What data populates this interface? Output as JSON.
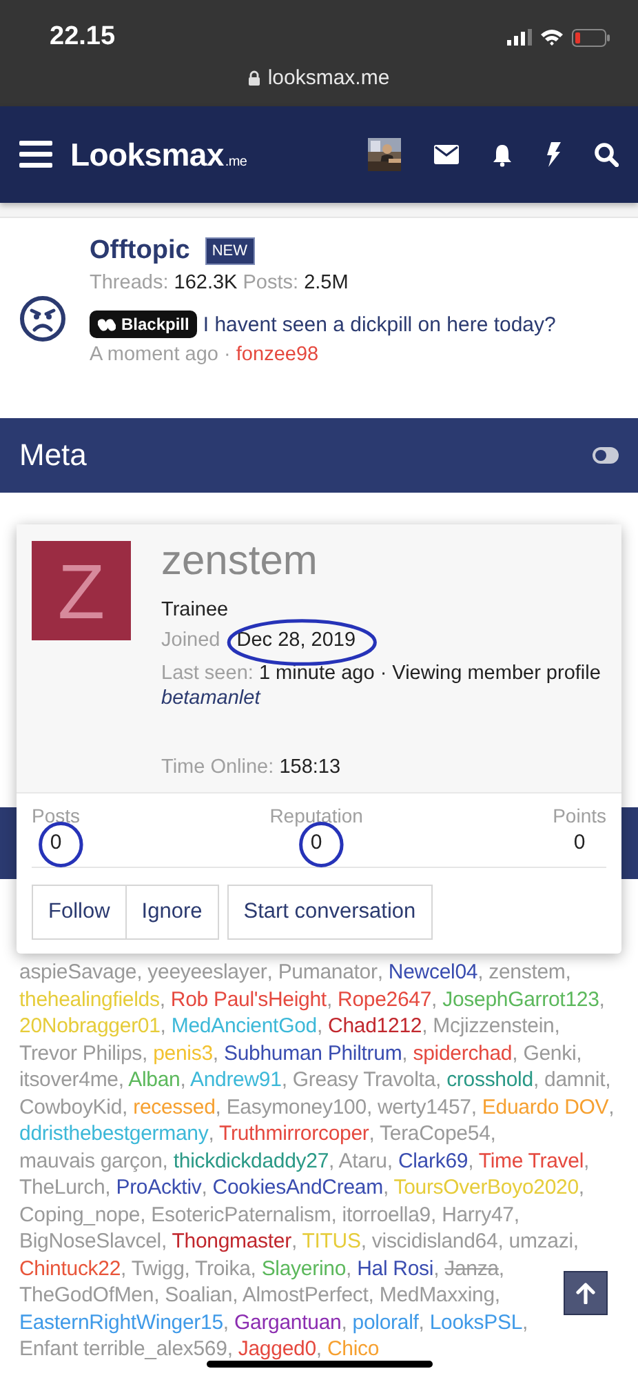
{
  "status_bar": {
    "time": "22.15",
    "url": "looksmax.me"
  },
  "nav": {
    "logo": "Looksmax",
    "logo_suffix": ".me"
  },
  "forum": {
    "title": "Offtopic",
    "badge": "NEW",
    "stats": [
      {
        "label": "Threads:",
        "value": "162.3K"
      },
      {
        "label": "Posts:",
        "value": "2.5M"
      }
    ],
    "latest": {
      "prefix": "Blackpill",
      "title": "I havent seen a dickpill on here today?",
      "time": "A moment ago",
      "separator": "·",
      "author": "fonzee98"
    }
  },
  "section": {
    "title": "Meta"
  },
  "member_card": {
    "avatar_letter": "Z",
    "username": "zenstem",
    "title": "Trainee",
    "joined_label": "Joined",
    "joined": "Dec 28, 2019",
    "joined_circled": true,
    "last_seen_label": "Last seen:",
    "last_seen": "1 minute ago · Viewing member profile",
    "activity_link": "betamanlet",
    "time_online_label": "Time Online:",
    "time_online": "158:13",
    "stats": [
      {
        "label": "Posts",
        "value": "0",
        "circled": true
      },
      {
        "label": "Reputation",
        "value": "0",
        "circled": true
      },
      {
        "label": "Points",
        "value": "0",
        "circled": false
      }
    ],
    "buttons": [
      "Follow",
      "Ignore",
      "Start conversation"
    ]
  },
  "online_users": {
    "separator": ",",
    "names": [
      {
        "name": "aspieSavage",
        "color": "#9a9a9a"
      },
      {
        "name": "yeeyeeslayer",
        "color": "#9a9a9a"
      },
      {
        "name": "Pumanator",
        "color": "#9a9a9a"
      },
      {
        "name": "Newcel04",
        "color": "#3a4db0"
      },
      {
        "name": "zenstem",
        "color": "#9a9a9a"
      },
      {
        "name": "thehealingfields",
        "color": "#e6cc3a"
      },
      {
        "name": "Rob Paul'sHeight",
        "color": "#e5493f"
      },
      {
        "name": "Rope2647",
        "color": "#e5493f"
      },
      {
        "name": "JosephGarrot123",
        "color": "#5cb85c"
      },
      {
        "name": "20Nobragger01",
        "color": "#e6cc3a"
      },
      {
        "name": "MedAncientGod",
        "color": "#3cb8d8"
      },
      {
        "name": "Chad1212",
        "color": "#c1272d"
      },
      {
        "name": "Mcjizzenstein",
        "color": "#9a9a9a"
      },
      {
        "name": "Trevor Philips",
        "color": "#9a9a9a"
      },
      {
        "name": "penis3",
        "color": "#f2c230"
      },
      {
        "name": "Subhuman Philtrum",
        "color": "#3a4db0"
      },
      {
        "name": "spiderchad",
        "color": "#e5493f"
      },
      {
        "name": "Genki",
        "color": "#9a9a9a"
      },
      {
        "name": "itsover4me",
        "color": "#9a9a9a"
      },
      {
        "name": "Alban",
        "color": "#5cb85c"
      },
      {
        "name": "Andrew91",
        "color": "#3cb8d8"
      },
      {
        "name": "Greasy Travolta",
        "color": "#9a9a9a"
      },
      {
        "name": "crosshold",
        "color": "#2a9986"
      },
      {
        "name": "damnit",
        "color": "#9a9a9a"
      },
      {
        "name": "CowboyKid",
        "color": "#9a9a9a"
      },
      {
        "name": "recessed",
        "color": "#f6a030"
      },
      {
        "name": "Easymoney100",
        "color": "#9a9a9a"
      },
      {
        "name": "werty1457",
        "color": "#9a9a9a"
      },
      {
        "name": "Eduardo DOV",
        "color": "#f6a030"
      },
      {
        "name": "ddristhebestgermany",
        "color": "#3cb8d8"
      },
      {
        "name": "Truthmirrorcoper",
        "color": "#e5493f"
      },
      {
        "name": "TeraCope54",
        "color": "#9a9a9a"
      },
      {
        "name": "mauvais garçon",
        "color": "#9a9a9a"
      },
      {
        "name": "thickdickdaddy27",
        "color": "#2a9986"
      },
      {
        "name": "Ataru",
        "color": "#9a9a9a"
      },
      {
        "name": "Clark69",
        "color": "#3a4db0"
      },
      {
        "name": "Time Travel",
        "color": "#e5493f"
      },
      {
        "name": "TheLurch",
        "color": "#9a9a9a"
      },
      {
        "name": "ProAcktiv",
        "color": "#3a4db0"
      },
      {
        "name": "CookiesAndCream",
        "color": "#3a4db0"
      },
      {
        "name": "ToursOverBoyo2020",
        "color": "#e6cc3a"
      },
      {
        "name": "Coping_nope",
        "color": "#9a9a9a"
      },
      {
        "name": "EsotericPaternalism",
        "color": "#9a9a9a"
      },
      {
        "name": "itorroella9",
        "color": "#9a9a9a"
      },
      {
        "name": "Harry47",
        "color": "#9a9a9a"
      },
      {
        "name": "BigNoseSlavcel",
        "color": "#9a9a9a"
      },
      {
        "name": "Thongmaster",
        "color": "#c1272d"
      },
      {
        "name": "TITUS",
        "color": "#e6cc3a"
      },
      {
        "name": "viscidisland64",
        "color": "#9a9a9a"
      },
      {
        "name": "umzazi",
        "color": "#9a9a9a"
      },
      {
        "name": "Chintuck22",
        "color": "#e8553a"
      },
      {
        "name": "Twigg",
        "color": "#9a9a9a"
      },
      {
        "name": "Troika",
        "color": "#9a9a9a"
      },
      {
        "name": "Slayerino",
        "color": "#5cb85c"
      },
      {
        "name": "Hal Rosi",
        "color": "#3a4db0"
      },
      {
        "name": "Janza",
        "color": "#9a9a9a",
        "struck": true
      },
      {
        "name": "TheGodOfMen",
        "color": "#9a9a9a"
      },
      {
        "name": "Soalian",
        "color": "#9a9a9a"
      },
      {
        "name": "AlmostPerfect",
        "color": "#9a9a9a"
      },
      {
        "name": "MedMaxxing",
        "color": "#9a9a9a"
      },
      {
        "name": "EasternRightWinger15",
        "color": "#3f9ae8"
      },
      {
        "name": "Gargantuan",
        "color": "#8b2cb0"
      },
      {
        "name": "poloralf",
        "color": "#3f9ae8"
      },
      {
        "name": "LooksPSL",
        "color": "#3f9ae8"
      },
      {
        "name": "Enfant terrible_alex569",
        "color": "#9a9a9a"
      },
      {
        "name": "Jagged0",
        "color": "#e5493f"
      },
      {
        "name": "Chico",
        "color": "#f6a030"
      }
    ]
  }
}
